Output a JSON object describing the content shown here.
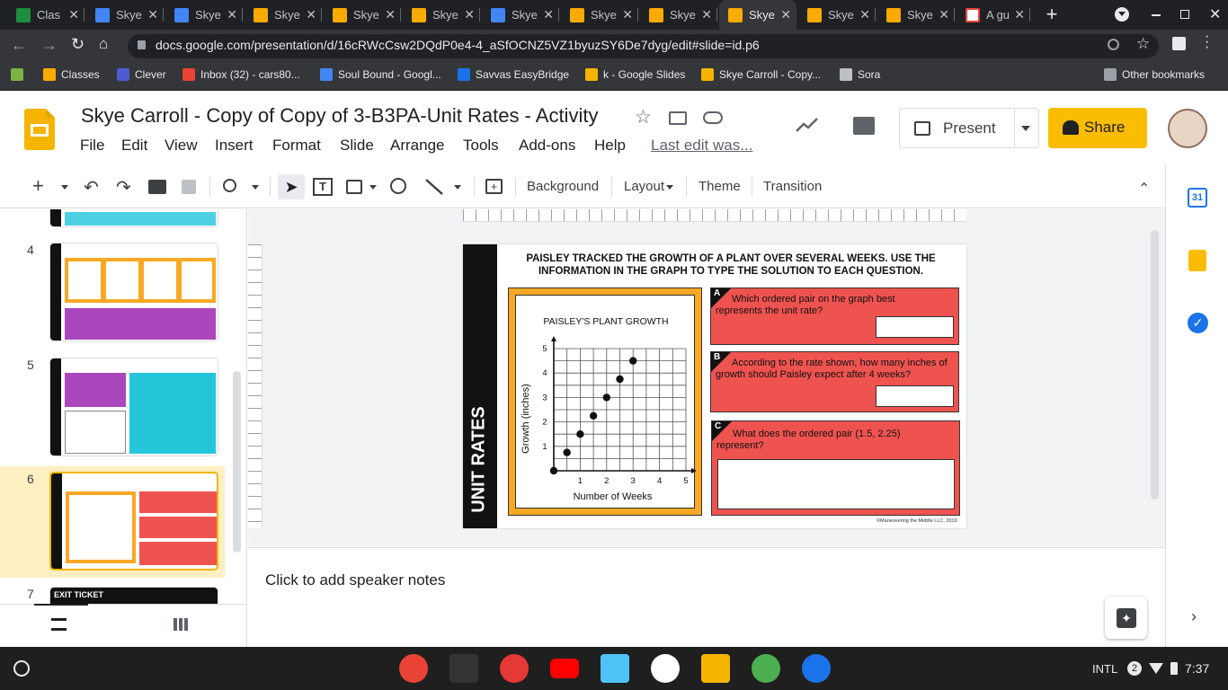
{
  "browser": {
    "tabs": [
      {
        "title": "Clas",
        "type": "classroom"
      },
      {
        "title": "Skye",
        "type": "docs"
      },
      {
        "title": "Skye",
        "type": "docs"
      },
      {
        "title": "Skye",
        "type": "slides"
      },
      {
        "title": "Skye",
        "type": "slides"
      },
      {
        "title": "Skye",
        "type": "slides"
      },
      {
        "title": "Skye",
        "type": "docs"
      },
      {
        "title": "Skye",
        "type": "slides"
      },
      {
        "title": "Skye",
        "type": "slides"
      },
      {
        "title": "Skye",
        "type": "slides",
        "active": true
      },
      {
        "title": "Skye",
        "type": "slides"
      },
      {
        "title": "Skye",
        "type": "slides"
      },
      {
        "title": "A gu",
        "type": "gmail"
      }
    ],
    "url": "docs.google.com/presentation/d/16cRWcCsw2DQdP0e4-4_aSfOCNZ5VZ1byuzSY6De7dyg/edit#slide=id.p6",
    "bookmarks": [
      {
        "label": "",
        "icon": "leaf-icon"
      },
      {
        "label": "Classes",
        "icon": "classes-icon"
      },
      {
        "label": "Clever",
        "icon": "clever-icon"
      },
      {
        "label": "Inbox (32) - cars80...",
        "icon": "gmail-icon"
      },
      {
        "label": "Soul Bound - Googl...",
        "icon": "docs-icon"
      },
      {
        "label": "Savvas EasyBridge",
        "icon": "savvas-icon"
      },
      {
        "label": "k - Google Slides",
        "icon": "slides-icon"
      },
      {
        "label": "Skye Carroll - Copy...",
        "icon": "slides-icon"
      },
      {
        "label": "Sora",
        "icon": "sora-icon"
      }
    ],
    "other_bookmarks": "Other bookmarks"
  },
  "app": {
    "title": "Skye Carroll - Copy of Copy of 3-B3PA-Unit Rates - Activity",
    "menus": [
      "File",
      "Edit",
      "View",
      "Insert",
      "Format",
      "Slide",
      "Arrange",
      "Tools",
      "Add-ons",
      "Help"
    ],
    "last_edit": "Last edit was...",
    "present_label": "Present",
    "share_label": "Share"
  },
  "toolbar": {
    "background_label": "Background",
    "layout_label": "Layout",
    "theme_label": "Theme",
    "transition_label": "Transition"
  },
  "filmstrip": {
    "slides": [
      {
        "number": "4"
      },
      {
        "number": "5"
      },
      {
        "number": "6",
        "selected": true
      },
      {
        "number": "7",
        "label": "EXIT TICKET"
      }
    ]
  },
  "slide": {
    "side_label": "UNIT RATES",
    "instructions": "PAISLEY TRACKED THE GROWTH OF A PLANT OVER SEVERAL WEEKS. USE THE INFORMATION IN THE GRAPH TO TYPE THE SOLUTION TO EACH QUESTION.",
    "questions": [
      {
        "letter": "A",
        "text": "Which ordered pair on the graph best represents the unit rate?"
      },
      {
        "letter": "B",
        "text": "According to the rate shown, how many inches of growth should Paisley expect after 4 weeks?"
      },
      {
        "letter": "C",
        "text": "What does the ordered pair (1.5, 2.25) represent?"
      }
    ],
    "copyright": "©Maneuvering the Middle LLC, 2019"
  },
  "chart_data": {
    "type": "scatter",
    "title": "PAISLEY'S PLANT GROWTH",
    "xlabel": "Number of Weeks",
    "ylabel": "Growth (inches)",
    "xlim": [
      0,
      5
    ],
    "ylim": [
      0,
      5
    ],
    "xticks": [
      "1",
      "2",
      "3",
      "4",
      "5"
    ],
    "yticks": [
      "1",
      "2",
      "3",
      "4",
      "5"
    ],
    "grid": true,
    "x": [
      0,
      0.5,
      1,
      1.5,
      2,
      2.5,
      3
    ],
    "y": [
      0,
      0.75,
      1.5,
      2.25,
      3,
      3.75,
      4.5
    ]
  },
  "notes": {
    "placeholder": "Click to add speaker notes"
  },
  "shelf": {
    "apps": [
      "chrome",
      "calculator",
      "photos",
      "youtube",
      "maps",
      "gmail",
      "slides",
      "paint",
      "files"
    ],
    "ime": "INTL",
    "notification_count": "2",
    "time": "7:37"
  }
}
